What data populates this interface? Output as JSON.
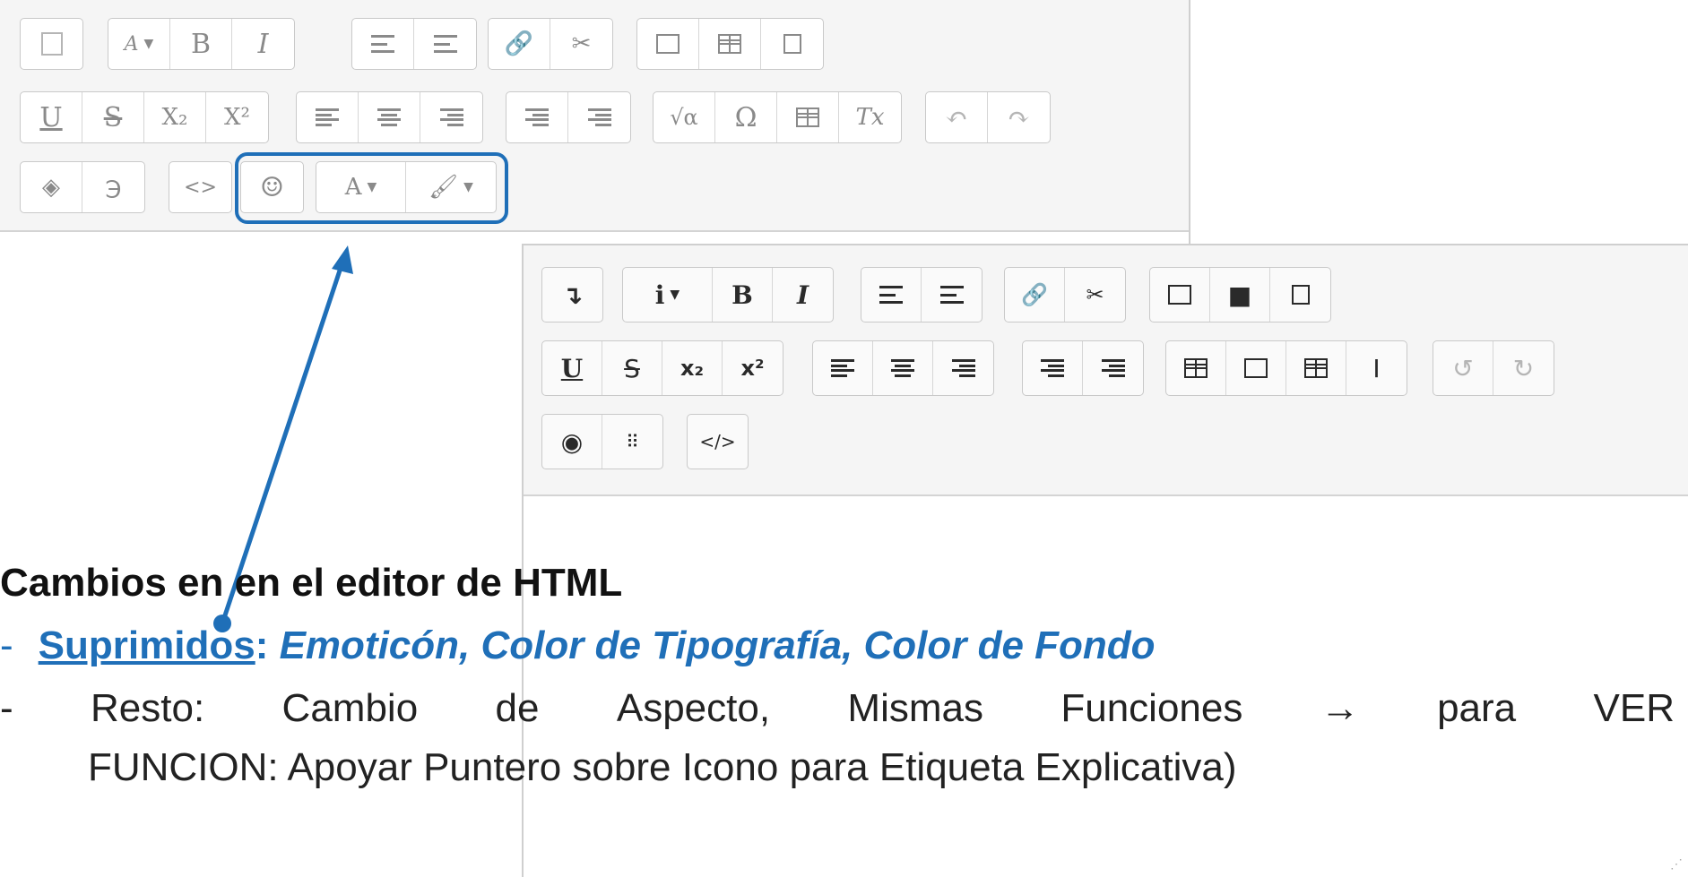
{
  "old_editor": {
    "rows": [
      [
        [
          "toolbar-toggle-icon"
        ],
        [
          "A",
          "B",
          "I"
        ],
        [
          "bullet-list-icon",
          "numbered-list-icon"
        ],
        [
          "link-icon",
          "unlink-icon"
        ],
        [
          "image-icon",
          "media-icon",
          "manage-files-icon"
        ]
      ],
      [
        [
          "U",
          "S",
          "X₂",
          "X²"
        ],
        [
          "align-left-icon",
          "align-center-icon",
          "align-right-icon"
        ],
        [
          "outdent-icon",
          "indent-icon"
        ],
        [
          "√α",
          "Ω",
          "table-icon",
          "Tx"
        ],
        [
          "undo-icon",
          "redo-icon"
        ]
      ],
      [
        [
          "accessibility-checker-icon",
          "screenreader-helper-icon"
        ],
        [
          "<>"
        ],
        [
          "☺"
        ],
        [
          "A",
          "paint-brush-icon"
        ]
      ]
    ]
  },
  "new_editor": {
    "rows": [
      [
        [
          "toolbar-toggle-icon"
        ],
        [
          "i",
          "B",
          "I"
        ],
        [
          "bullet-list-icon",
          "numbered-list-icon"
        ],
        [
          "link-icon",
          "unlink-icon"
        ],
        [
          "image-icon",
          "video-icon",
          "copy-icon"
        ]
      ],
      [
        [
          "U",
          "S",
          "x₂",
          "x²"
        ],
        [
          "align-left-icon",
          "align-center-icon",
          "align-right-icon"
        ],
        [
          "outdent-icon",
          "indent-icon"
        ],
        [
          "calculator-icon",
          "edit-icon",
          "table-icon",
          "I"
        ],
        [
          "undo-icon",
          "redo-icon"
        ]
      ],
      [
        [
          "accessibility-icon",
          "braille-icon"
        ],
        [
          "</>"
        ]
      ]
    ]
  },
  "caption": {
    "heading": "Cambios en en el editor de HTML",
    "removed_label": "Suprimidos",
    "removed_colon": ":",
    "removed_items": "Emoticón, Color de Tipografía, Color de Fondo",
    "rest_words": [
      "Resto:",
      "Cambio",
      "de",
      "Aspecto,",
      "Mismas",
      "Funciones",
      "→",
      "para",
      "VER"
    ],
    "rest_line2": "FUNCION: Apoyar Puntero sobre Icono para Etiqueta Explicativa)",
    "dash": "-"
  },
  "colors": {
    "accent": "#1f6fb8"
  }
}
